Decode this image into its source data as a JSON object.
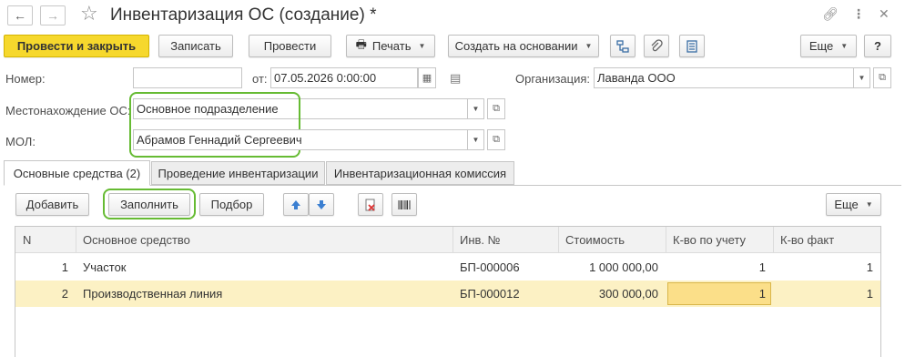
{
  "window": {
    "title": "Инвентаризация ОС (создание) *"
  },
  "toolbar": {
    "post_and_close": "Провести и закрыть",
    "save": "Записать",
    "post": "Провести",
    "print": "Печать",
    "create_based_on": "Создать на основании",
    "more": "Еще",
    "help": "?"
  },
  "fields": {
    "number_label": "Номер:",
    "number_value": "",
    "date_label": "от:",
    "date_value": "07.05.2026  0:00:00",
    "org_label": "Организация:",
    "org_value": "Лаванда ООО",
    "location_label": "Местонахождение ОС:",
    "location_value": "Основное подразделение",
    "mol_label": "МОЛ:",
    "mol_value": "Абрамов Геннадий Сергеевич"
  },
  "tabs": [
    {
      "label": "Основные средства (2)",
      "active": true
    },
    {
      "label": "Проведение инвентаризации",
      "active": false
    },
    {
      "label": "Инвентаризационная комиссия",
      "active": false
    }
  ],
  "table_toolbar": {
    "add": "Добавить",
    "fill": "Заполнить",
    "select": "Подбор",
    "more": "Еще"
  },
  "table": {
    "columns": [
      "N",
      "Основное средство",
      "Инв. №",
      "Стоимость",
      "К-во по учету",
      "К-во факт"
    ],
    "rows": [
      {
        "n": "1",
        "asset": "Участок",
        "inv": "БП-000006",
        "cost": "1 000 000,00",
        "qty_book": "1",
        "qty_fact": "1"
      },
      {
        "n": "2",
        "asset": "Производственная линия",
        "inv": "БП-000012",
        "cost": "300 000,00",
        "qty_book": "1",
        "qty_fact": "1"
      }
    ]
  },
  "colors": {
    "primary_button": "#f6d82d",
    "highlight_outline": "#66bb33",
    "selected_row": "#fcf1c4",
    "focused_cell": "#fbdf89"
  }
}
